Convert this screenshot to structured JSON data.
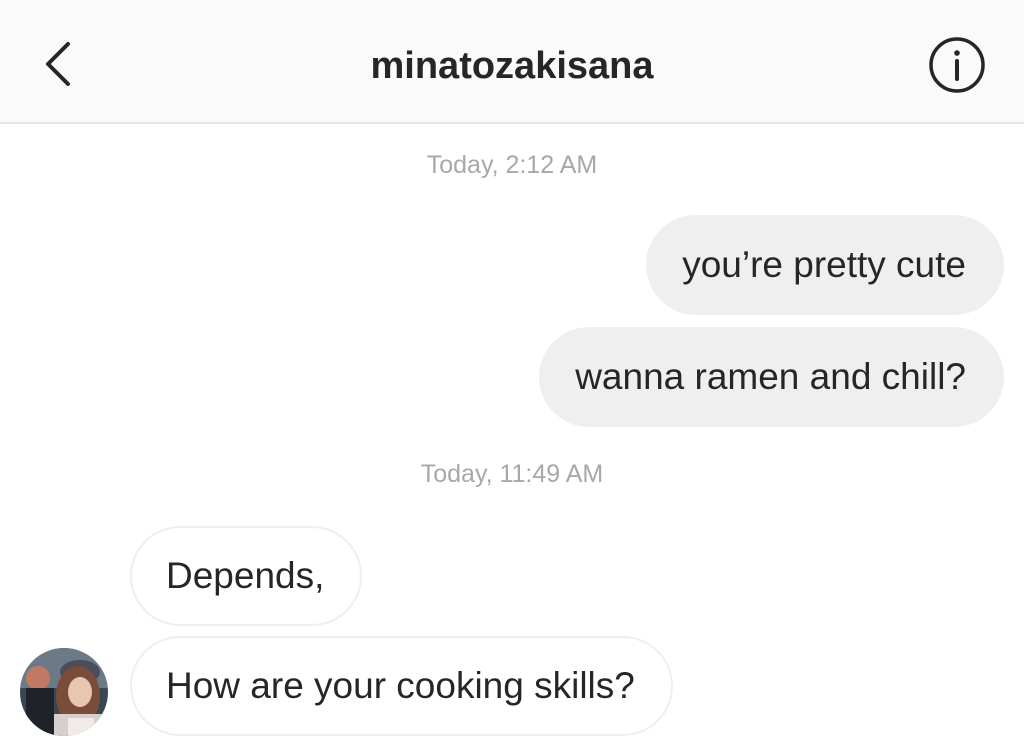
{
  "header": {
    "title": "minatozakisana",
    "back_icon": "chevron-left-icon",
    "info_icon": "info-circle-icon"
  },
  "thread": {
    "timestamps": [
      "Today, 2:12 AM",
      "Today, 11:49 AM"
    ],
    "sent_messages": [
      "you’re pretty cute",
      "wanna ramen and chill?"
    ],
    "received_messages": [
      "Depends,",
      "How are your cooking skills?"
    ]
  },
  "colors": {
    "header_bg": "#fafafa",
    "sent_bubble": "#efefef",
    "received_border": "#efefef",
    "timestamp_text": "#a8a8a8",
    "text": "#262626"
  }
}
